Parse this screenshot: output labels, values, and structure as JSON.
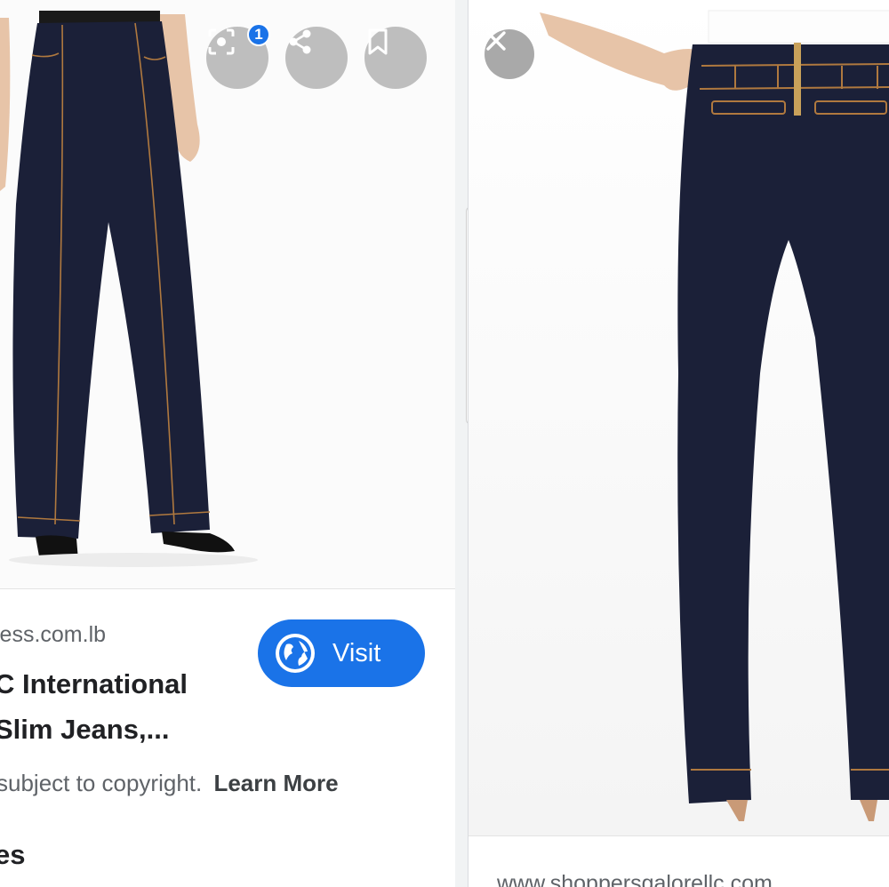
{
  "left_result": {
    "source_domain": "less.com.lb",
    "title_line_1": "C International",
    "title_line_2": "Slim Jeans,...",
    "visit_label": "Visit",
    "copyright_text": "subject to copyright.",
    "learn_more_label": "Learn More",
    "section_heading": "es",
    "lens_badge_count": "1",
    "icons": {
      "lens": "lens-icon",
      "share": "share-icon",
      "bookmark": "bookmark-icon",
      "globe": "globe-icon"
    }
  },
  "right_result": {
    "source_domain": "www.shoppersgalorellc.com",
    "icons": {
      "close": "close-icon"
    }
  },
  "colors": {
    "accent": "#1a73e8",
    "denim": "#1b2038",
    "stitch": "#b0793f",
    "muted_text": "#5f6368"
  }
}
